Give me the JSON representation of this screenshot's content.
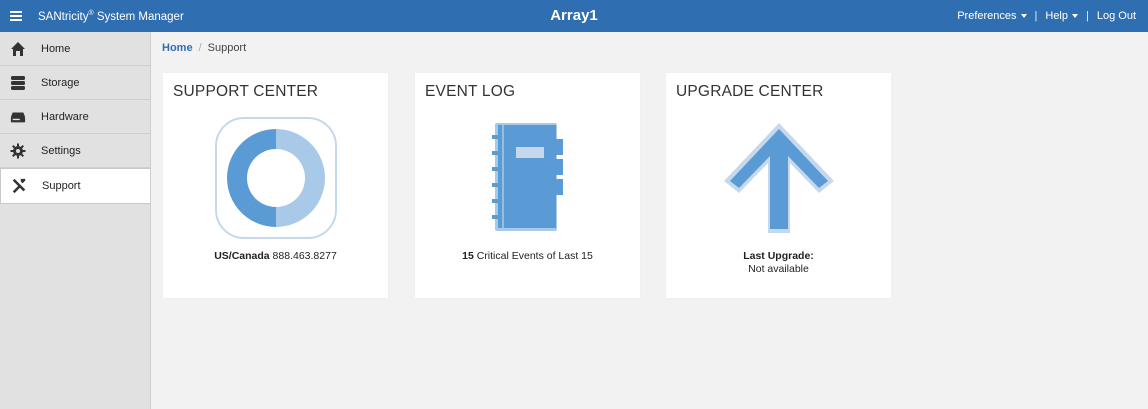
{
  "app": {
    "brand": "SANtricity",
    "brand_reg": "®",
    "brand_suffix": " System Manager",
    "array_name": "Array1",
    "menu_icon": "hamburger-icon"
  },
  "top_links": {
    "preferences": "Preferences",
    "help": "Help",
    "logout": "Log Out",
    "separator": "|"
  },
  "sidebar": {
    "items": [
      {
        "label": "Home",
        "icon": "home-icon"
      },
      {
        "label": "Storage",
        "icon": "storage-icon"
      },
      {
        "label": "Hardware",
        "icon": "hardware-icon"
      },
      {
        "label": "Settings",
        "icon": "gear-icon"
      },
      {
        "label": "Support",
        "icon": "tools-icon",
        "active": true
      }
    ]
  },
  "breadcrumb": {
    "home": "Home",
    "separator": "/",
    "current": "Support"
  },
  "cards": {
    "support": {
      "title": "SUPPORT CENTER",
      "icon": "lifebuoy-icon",
      "caption_bold": "US/Canada",
      "caption_text": " 888.463.8277"
    },
    "events": {
      "title": "EVENT LOG",
      "icon": "notebook-icon",
      "caption_bold": "15",
      "caption_text": " Critical Events of Last 15"
    },
    "upgrade": {
      "title": "UPGRADE CENTER",
      "icon": "up-arrow-icon",
      "caption_bold": "Last Upgrade:",
      "caption_text": "Not available"
    }
  },
  "colors": {
    "topbar": "#2f6fb1",
    "icon_blue": "#5b9bd5",
    "icon_light": "#a9c9e8",
    "sidebar_bg": "#e1e1e1",
    "main_bg": "#f2f2f2"
  }
}
